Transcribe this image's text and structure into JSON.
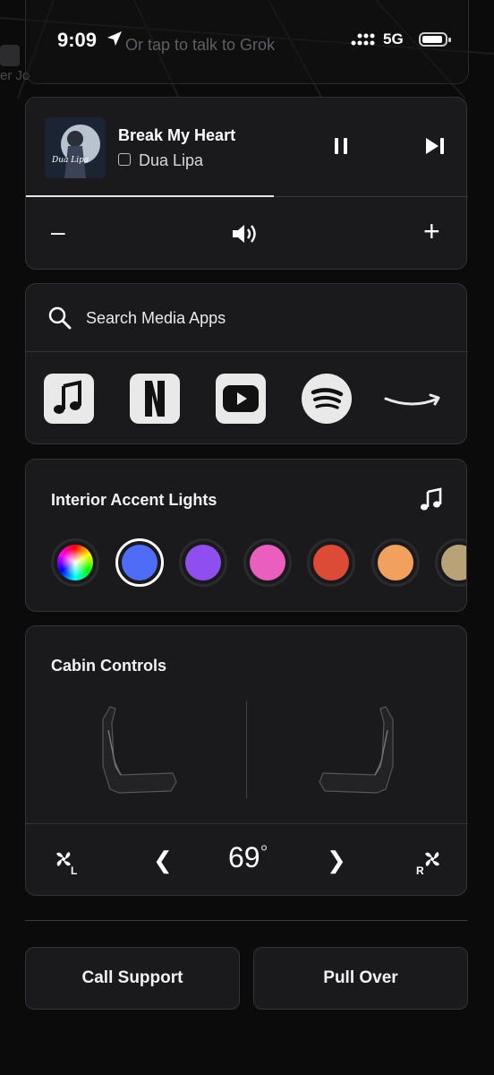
{
  "status_bar": {
    "time": "9:09",
    "network": "5G"
  },
  "background": {
    "voice_hint": "Or tap to talk to Grok",
    "side_text": "er Jo"
  },
  "now_playing": {
    "song": "Break My Heart",
    "artist": "Dua Lipa",
    "progress_fraction": 0.56
  },
  "media_search": {
    "placeholder": "Search Media Apps"
  },
  "media_apps": [
    "music-app-icon",
    "netflix-icon",
    "youtube-icon",
    "spotify-icon",
    "amazon-music-icon"
  ],
  "accent_lights": {
    "title": "Interior Accent Lights",
    "colors": [
      {
        "name": "rainbow"
      },
      {
        "name": "blue",
        "hex": "#4f6cf7",
        "selected": true
      },
      {
        "name": "purple",
        "hex": "#8f4ef0"
      },
      {
        "name": "pink",
        "hex": "#ea5fbe"
      },
      {
        "name": "red",
        "hex": "#dd4a35"
      },
      {
        "name": "orange",
        "hex": "#f2a05d"
      },
      {
        "name": "gold",
        "hex": "#b7a377"
      }
    ]
  },
  "cabin": {
    "title": "Cabin Controls",
    "temperature": "69",
    "degree": "°",
    "fan_left_label": "L",
    "fan_right_label": "R"
  },
  "actions": {
    "call_support": "Call Support",
    "pull_over": "Pull Over"
  }
}
